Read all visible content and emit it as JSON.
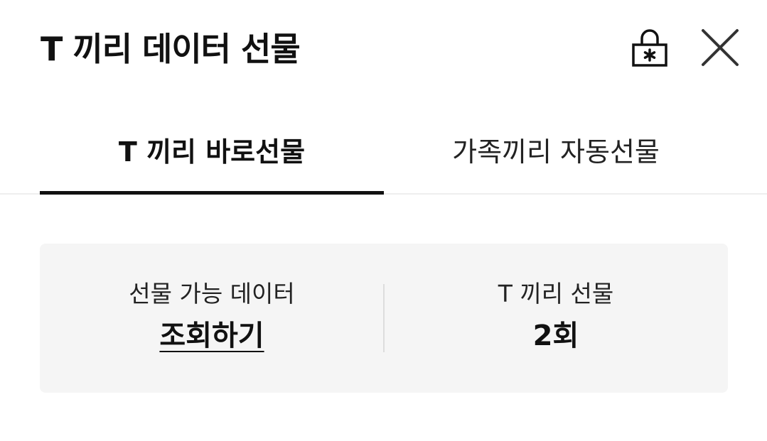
{
  "header": {
    "title": "T 끼리 데이터 선물",
    "lock_icon": "lock-asterisk-icon",
    "close_icon": "close-icon"
  },
  "tabs": [
    {
      "label": "T 끼리 바로선물",
      "active": true
    },
    {
      "label": "가족끼리 자동선물",
      "active": false
    }
  ],
  "summary": {
    "available": {
      "label": "선물 가능 데이터",
      "value": "조회하기"
    },
    "count": {
      "label": "T 끼리 선물",
      "value": "2회"
    }
  },
  "colors": {
    "text": "#111111",
    "card_background": "#f5f5f5",
    "divider": "#dddddd",
    "tab_indicator": "#111111"
  }
}
